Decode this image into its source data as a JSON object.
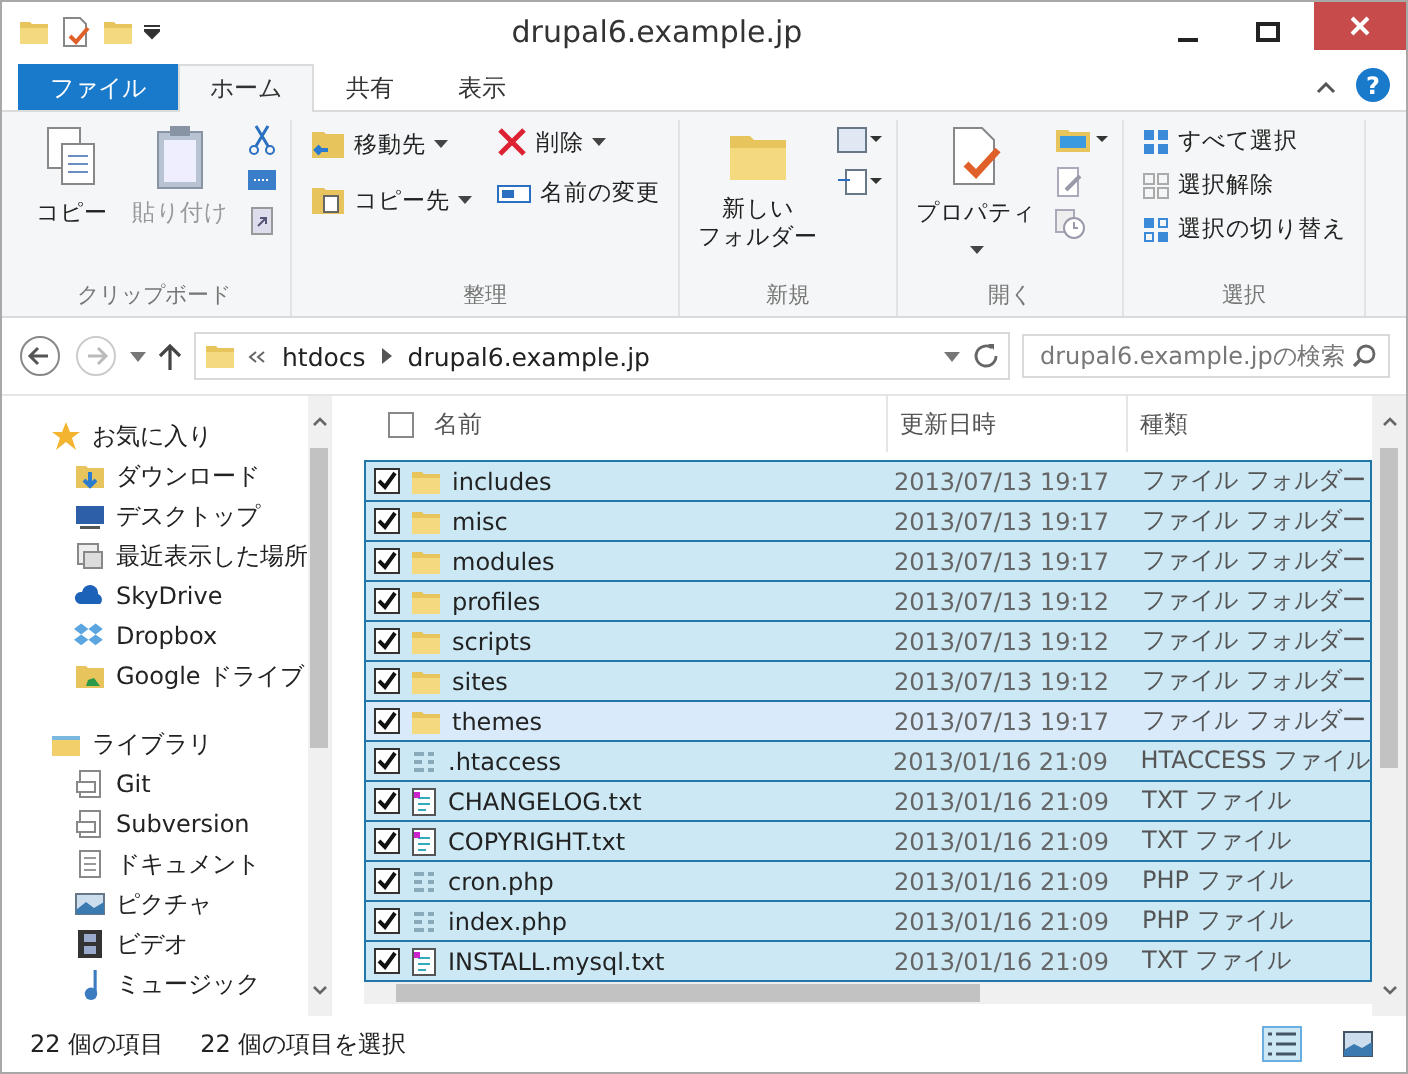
{
  "window": {
    "title": "drupal6.example.jp"
  },
  "tabs": [
    {
      "label": "ファイル",
      "kind": "file",
      "selected": false
    },
    {
      "label": "ホーム",
      "kind": "tab",
      "selected": true
    },
    {
      "label": "共有",
      "kind": "tab",
      "selected": false
    },
    {
      "label": "表示",
      "kind": "tab",
      "selected": false
    }
  ],
  "help": "?",
  "ribbon": {
    "groups": [
      {
        "label": "クリップボード",
        "kind": "clipboard",
        "buttons": [
          {
            "label": "コピー",
            "disabled": false
          },
          {
            "label": "貼り付け",
            "disabled": true
          }
        ]
      },
      {
        "label": "整理",
        "kind": "organize",
        "buttons": [
          {
            "label": "移動先"
          },
          {
            "label": "コピー先"
          },
          {
            "label": "削除"
          },
          {
            "label": "名前の変更"
          }
        ]
      },
      {
        "label": "新規",
        "kind": "new",
        "buttons": [
          {
            "lines": [
              "新しい",
              "フォルダー"
            ]
          }
        ]
      },
      {
        "label": "開く",
        "kind": "open",
        "buttons": [
          {
            "label": "プロパティ"
          }
        ]
      },
      {
        "label": "選択",
        "kind": "select",
        "buttons": [
          {
            "label": "すべて選択"
          },
          {
            "label": "選択解除"
          },
          {
            "label": "選択の切り替え"
          }
        ]
      }
    ]
  },
  "address": {
    "path": [
      "htdocs",
      "drupal6.example.jp"
    ],
    "search_placeholder": "drupal6.example.jpの検索"
  },
  "sidebar": {
    "sections": [
      {
        "label": "お気に入り",
        "kind": "favorites",
        "items": [
          {
            "label": "ダウンロード",
            "kind": "download"
          },
          {
            "label": "デスクトップ",
            "kind": "desktop"
          },
          {
            "label": "最近表示した場所",
            "kind": "recent"
          },
          {
            "label": "SkyDrive",
            "kind": "cloud"
          },
          {
            "label": "Dropbox",
            "kind": "dropbox"
          },
          {
            "label": "Google ドライブ",
            "kind": "gdrive"
          }
        ]
      },
      {
        "label": "ライブラリ",
        "kind": "library",
        "items": [
          {
            "label": "Git",
            "kind": "lib"
          },
          {
            "label": "Subversion",
            "kind": "lib"
          },
          {
            "label": "ドキュメント",
            "kind": "doc"
          },
          {
            "label": "ピクチャ",
            "kind": "picture"
          },
          {
            "label": "ビデオ",
            "kind": "video"
          },
          {
            "label": "ミュージック",
            "kind": "music"
          }
        ]
      }
    ]
  },
  "table": {
    "columns": [
      "名前",
      "更新日時",
      "種類"
    ],
    "all_checked": false,
    "rows": [
      {
        "name": "includes",
        "date": "2013/07/13 19:17",
        "type": "ファイル フォルダー",
        "kind": "folder",
        "selected": true,
        "checked": true,
        "focused": false
      },
      {
        "name": "misc",
        "date": "2013/07/13 19:17",
        "type": "ファイル フォルダー",
        "kind": "folder",
        "selected": true,
        "checked": true,
        "focused": false
      },
      {
        "name": "modules",
        "date": "2013/07/13 19:17",
        "type": "ファイル フォルダー",
        "kind": "folder",
        "selected": true,
        "checked": true,
        "focused": false
      },
      {
        "name": "profiles",
        "date": "2013/07/13 19:12",
        "type": "ファイル フォルダー",
        "kind": "folder",
        "selected": true,
        "checked": true,
        "focused": false
      },
      {
        "name": "scripts",
        "date": "2013/07/13 19:12",
        "type": "ファイル フォルダー",
        "kind": "folder",
        "selected": true,
        "checked": true,
        "focused": false
      },
      {
        "name": "sites",
        "date": "2013/07/13 19:12",
        "type": "ファイル フォルダー",
        "kind": "folder",
        "selected": true,
        "checked": true,
        "focused": false
      },
      {
        "name": "themes",
        "date": "2013/07/13 19:17",
        "type": "ファイル フォルダー",
        "kind": "folder",
        "selected": true,
        "checked": true,
        "focused": true
      },
      {
        "name": ".htaccess",
        "date": "2013/01/16 21:09",
        "type": "HTACCESS ファイル",
        "kind": "generic",
        "selected": true,
        "checked": true,
        "focused": false
      },
      {
        "name": "CHANGELOG.txt",
        "date": "2013/01/16 21:09",
        "type": "TXT ファイル",
        "kind": "text",
        "selected": true,
        "checked": true,
        "focused": false
      },
      {
        "name": "COPYRIGHT.txt",
        "date": "2013/01/16 21:09",
        "type": "TXT ファイル",
        "kind": "text",
        "selected": true,
        "checked": true,
        "focused": false
      },
      {
        "name": "cron.php",
        "date": "2013/01/16 21:09",
        "type": "PHP ファイル",
        "kind": "generic",
        "selected": true,
        "checked": true,
        "focused": false
      },
      {
        "name": "index.php",
        "date": "2013/01/16 21:09",
        "type": "PHP ファイル",
        "kind": "generic",
        "selected": true,
        "checked": true,
        "focused": false
      },
      {
        "name": "INSTALL.mysql.txt",
        "date": "2013/01/16 21:09",
        "type": "TXT ファイル",
        "kind": "text",
        "selected": true,
        "checked": true,
        "focused": false
      }
    ]
  },
  "status_bar": {
    "items": [
      "22 個の項目",
      "22 個の項目を選択"
    ],
    "view_buttons": [
      {
        "kind": "details",
        "selected": true
      },
      {
        "kind": "icons",
        "selected": false
      }
    ]
  }
}
